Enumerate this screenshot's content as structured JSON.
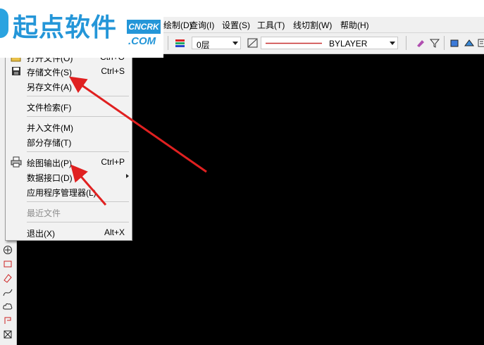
{
  "menubar": {
    "items": [
      "绘制(D)",
      "查询(I)",
      "设置(S)",
      "工具(T)",
      "线切割(W)",
      "帮助(H)"
    ]
  },
  "toolbar": {
    "layer_value": "0层",
    "linetype_value": "BYLAYER"
  },
  "file_menu": {
    "items": [
      {
        "label": "打开文件(O)",
        "shortcut": "Ctrl+O"
      },
      {
        "label": "存储文件(S)",
        "shortcut": "Ctrl+S"
      },
      {
        "label": "另存文件(A)",
        "shortcut": ""
      },
      {
        "label": "文件检索(F)",
        "shortcut": ""
      },
      {
        "label": "并入文件(M)",
        "shortcut": ""
      },
      {
        "label": "部分存储(T)",
        "shortcut": ""
      },
      {
        "label": "绘图输出(P)",
        "shortcut": "Ctrl+P"
      },
      {
        "label": "数据接口(D)",
        "shortcut": ""
      },
      {
        "label": "应用程序管理器(L)",
        "shortcut": ""
      },
      {
        "label": "最近文件",
        "shortcut": ""
      },
      {
        "label": "退出(X)",
        "shortcut": "Alt+X"
      }
    ]
  },
  "watermark": {
    "text": "起点软件",
    "badge": "CNCRK",
    "domain": ".COM"
  },
  "colors": {
    "canvas": "#000000",
    "annotation_arrow": "#e02020",
    "brand_blue": "#2496d8"
  }
}
